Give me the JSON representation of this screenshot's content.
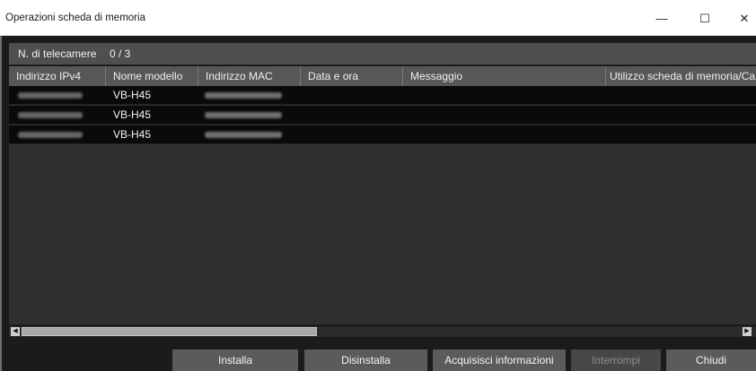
{
  "window": {
    "title": "Operazioni scheda di memoria",
    "controls": {
      "minimize": "—",
      "maximize": "☐",
      "close": "✕"
    }
  },
  "info": {
    "camera_count_label": "N. di telecamere",
    "camera_count_value": "0 / 3"
  },
  "table": {
    "columns": [
      "Indirizzo IPv4",
      "Nome modello",
      "Indirizzo MAC",
      "Data e ora",
      "Messaggio",
      "Utilizzo scheda di memoria/Ca"
    ],
    "rows": [
      {
        "ip": "",
        "model": "VB-H45",
        "mac": "",
        "date": "",
        "message": "",
        "usage": ""
      },
      {
        "ip": "",
        "model": "VB-H45",
        "mac": "",
        "date": "",
        "message": "",
        "usage": ""
      },
      {
        "ip": "",
        "model": "VB-H45",
        "mac": "",
        "date": "",
        "message": "",
        "usage": ""
      }
    ]
  },
  "scrollbar": {
    "left_icon": "◀",
    "right_icon": "▶"
  },
  "buttons": {
    "install": "Installa",
    "uninstall": "Disinstalla",
    "acquire": "Acquisisci informazioni",
    "stop": "Interrompi",
    "close": "Chiudi"
  }
}
